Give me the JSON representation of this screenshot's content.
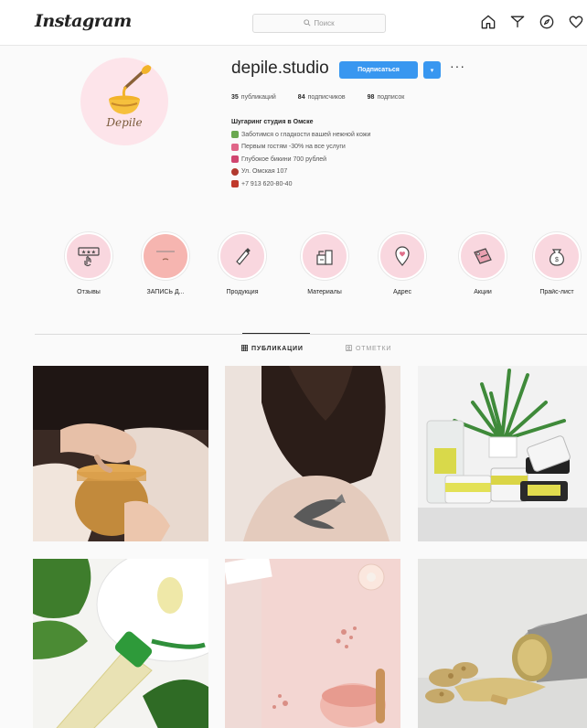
{
  "nav": {
    "logo": "Instagram",
    "search_placeholder": "Поиск"
  },
  "profile": {
    "username": "depile.studio",
    "avatar_text": "Depile",
    "follow_label": "Подписаться",
    "more_label": "···",
    "stats": {
      "posts_count": "35",
      "posts_label": "публикаций",
      "followers_count": "84",
      "followers_label": "подписчиков",
      "following_count": "98",
      "following_label": "подписок"
    },
    "bio": {
      "name": "Шугаринг студия в Омске",
      "lines": [
        "Заботимся о гладкости вашей нежной кожи",
        "Первым гостям -30% на все услуги",
        "Глубокое бикини 700 рублей",
        "Ул. Омская 107",
        "+7 913 620-80-40"
      ]
    }
  },
  "highlights": [
    {
      "label": "Отзывы",
      "icon": "stars-hand-icon"
    },
    {
      "label": "ЗАПИСЬ Д...",
      "icon": "booking-icon"
    },
    {
      "label": "Продукция",
      "icon": "tube-icon"
    },
    {
      "label": "Материалы",
      "icon": "materials-icon"
    },
    {
      "label": "Адрес",
      "icon": "location-pin-icon"
    },
    {
      "label": "Акции",
      "icon": "sale-tag-icon"
    },
    {
      "label": "Прайс-лист",
      "icon": "money-bag-icon"
    }
  ],
  "tabs": {
    "posts": "ПУБЛИКАЦИИ",
    "tagged": "ОТМЕТКИ"
  },
  "posts": [
    {
      "subject": "hand-dipping-into-sugar-paste-jar"
    },
    {
      "subject": "woman-back-with-tattoo"
    },
    {
      "subject": "products-with-spider-plant"
    },
    {
      "subject": "leaf-and-oil-bottle"
    },
    {
      "subject": "pink-salt-flatlay"
    },
    {
      "subject": "spilled-ginger-powder-tin"
    }
  ],
  "colors": {
    "accent_blue": "#3897f0",
    "highlight_pink": "#f9d7df",
    "avatar_pink": "#fde4ea"
  }
}
